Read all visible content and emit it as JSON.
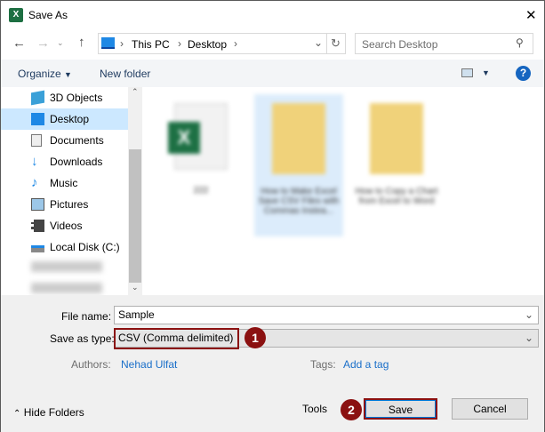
{
  "window": {
    "title": "Save As",
    "close": "✕"
  },
  "nav": {
    "breadcrumb": [
      "This PC",
      "Desktop"
    ],
    "search_placeholder": "Search Desktop"
  },
  "toolbar": {
    "organize": "Organize",
    "new_folder": "New folder",
    "help": "?"
  },
  "sidebar": {
    "items": [
      {
        "label": "3D Objects",
        "icon": "cube-icon"
      },
      {
        "label": "Desktop",
        "icon": "desktop-icon",
        "selected": true
      },
      {
        "label": "Documents",
        "icon": "documents-icon"
      },
      {
        "label": "Downloads",
        "icon": "download-icon"
      },
      {
        "label": "Music",
        "icon": "music-icon"
      },
      {
        "label": "Pictures",
        "icon": "pictures-icon"
      },
      {
        "label": "Videos",
        "icon": "videos-icon"
      },
      {
        "label": "Local Disk (C:)",
        "icon": "drive-icon"
      }
    ]
  },
  "files": [
    {
      "name": "222",
      "type": "excel"
    },
    {
      "name": "How to Make Excel Save CSV Files with Commas Instea...",
      "type": "folder"
    },
    {
      "name": "How to Copy a Chart from Excel to Word",
      "type": "folder"
    }
  ],
  "form": {
    "file_name_label": "File name:",
    "file_name": "Sample",
    "type_label": "Save as type:",
    "type_value": "CSV (Comma delimited)",
    "authors_label": "Authors:",
    "authors": "Nehad  Ulfat",
    "tags_label": "Tags:",
    "tags_value": "Add a tag"
  },
  "footer": {
    "hide_folders": "Hide Folders",
    "tools": "Tools",
    "save": "Save",
    "cancel": "Cancel"
  },
  "annotations": {
    "step1": "1",
    "step2": "2"
  },
  "colors": {
    "highlight": "#8b1111",
    "link": "#1a6fc9",
    "selected": "#cce8ff"
  }
}
